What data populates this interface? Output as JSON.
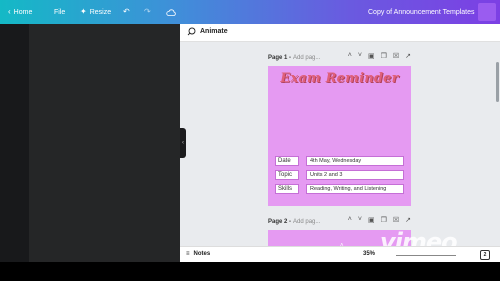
{
  "topbar": {
    "home_label": "Home",
    "file_label": "File",
    "resize_label": "Resize",
    "document_title": "Copy of Announcement Templates"
  },
  "editor": {
    "animate_label": "Animate",
    "pages": [
      {
        "name": "Page 1 -",
        "title_placeholder": "Add pag..."
      },
      {
        "name": "Page 2 -",
        "title_placeholder": "Add pag..."
      }
    ]
  },
  "design": {
    "title": "Exam Reminder",
    "rows": [
      {
        "label": "Date",
        "value": "4th May, Wednesday"
      },
      {
        "label": "Topic",
        "value": "Units 2 and 3"
      },
      {
        "label": "Skills",
        "value": "Reading, Writing, and Listening"
      }
    ]
  },
  "bottombar": {
    "notes_label": "Notes",
    "zoom": "35%",
    "page_count": "2"
  },
  "watermark": "vimeo",
  "colors": {
    "page_background": "#e59af2",
    "title_color": "#e0607a",
    "topbar_start": "#14b9c6",
    "topbar_end": "#7c3fe4"
  }
}
